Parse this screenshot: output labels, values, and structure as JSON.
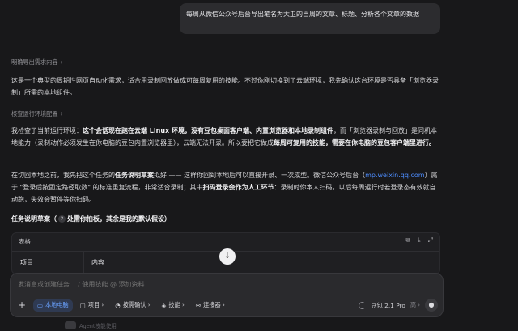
{
  "user_message": "每周从微信公众号后台导出笔名为大卫的当周的文章、标题、分析各个文章的数据",
  "sections": {
    "clarify_label": "明确导出需求内容",
    "env_label": "核查运行环境配置"
  },
  "paragraphs": {
    "p1": "这是一个典型的周期性网页自动化需求，适合用录制回放做成可每周复用的技能。不过你刚切换到了云端环境，我先确认这台环境是否具备「浏览器录制」所需的本地组件。",
    "p2_a": "我检查了当前运行环境：",
    "p2_b": "这个会话现在跑在云端 Linux 环境，没有豆包桌面客户端、内置浏览器和本地录制组件",
    "p2_c": "，而「浏览器录制与回放」是同机本地能力（录制动作必须发生在你电脑的豆包内置浏览器里），云端无法开录。所以要把它做成",
    "p2_d": "每周可复用的技能，需要在你电脑的豆包客户端里进行。",
    "p3_a": "在切回本地之前，我先把这个任务的",
    "p3_b": "任务说明草案",
    "p3_c": "拟好 —— 这样你回到本地后可以直接开录、一次成型。微信公众号后台（",
    "p3_link": "mp.weixin.qq.com",
    "p3_d": "）属于 \"登录后按固定路径取数\" 的标准重复流程，非常适合录制；其中",
    "p3_e": "扫码登录会作为人工环节",
    "p3_f": "：录制时你本人扫码，以后每周运行时若登录态有效就自动跑，失效会暂停等你扫码。"
  },
  "task": {
    "title_a": "任务说明草案（",
    "title_q": "?",
    "title_b": " 处需你拍板，其余是我的默认假设）"
  },
  "table": {
    "label": "表格",
    "col1": "项目",
    "col2": "内容"
  },
  "composer": {
    "placeholder": "发消息或创建任务... / 使用技能 @ 添加资料",
    "chips": [
      {
        "icon": "laptop-icon",
        "glyph": "▭",
        "label": "本地电脑",
        "active": true
      },
      {
        "icon": "folder-icon",
        "glyph": "▢",
        "label": "项目 ›",
        "active": false
      },
      {
        "icon": "shield-icon",
        "glyph": "◔",
        "label": "按需确认 ›",
        "active": false
      },
      {
        "icon": "layers-icon",
        "glyph": "◈",
        "label": "技能 ›",
        "active": false
      },
      {
        "icon": "plug-icon",
        "glyph": "⚯",
        "label": "连接器 ›",
        "active": false
      }
    ],
    "model": "豆包 2.1 Pro",
    "model_sub": "高 ›"
  },
  "footer": "Agent技能使用"
}
